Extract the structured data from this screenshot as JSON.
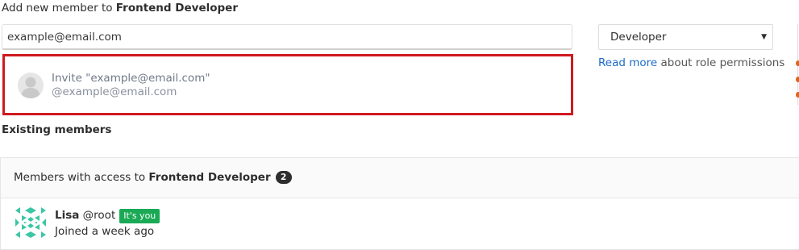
{
  "add_member": {
    "title_prefix": "Add new member to",
    "group_name": "Frontend Developer"
  },
  "invite_input": {
    "value": "example@email.com"
  },
  "invite_dropdown": {
    "item_line1": "Invite \"example@email.com\"",
    "item_line2": "@example@email.com"
  },
  "role_select": {
    "selected": "Developer",
    "arrow": "▼"
  },
  "role_help": {
    "link": "Read more",
    "suffix": "about role permissions"
  },
  "existing_members": {
    "title": "Existing members",
    "header_prefix": "Members with access to",
    "header_group": "Frontend Developer",
    "count": "2"
  },
  "members": [
    {
      "name": "Lisa",
      "username": "@root",
      "badge": "It's you",
      "joined": "Joined a week ago"
    }
  ],
  "colors": {
    "highlight_border": "#d0191f",
    "link": "#1b6ac9",
    "badge_green": "#1aaa55",
    "identicon": "#3cc6a5",
    "accent_orange": "#e3661f"
  },
  "icons": {
    "dropdown_avatar": "default-user-avatar-icon",
    "member_avatar": "identicon-avatar-icon",
    "select_arrow": "caret-down-icon"
  }
}
